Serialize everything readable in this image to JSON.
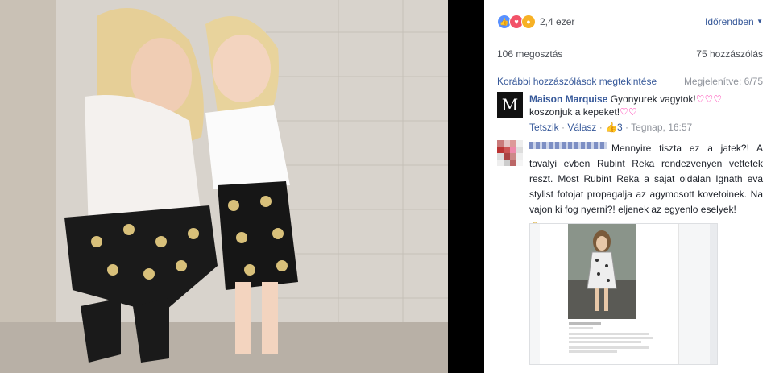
{
  "reactions": {
    "icons": [
      "like-icon",
      "love-icon",
      "wow-icon"
    ],
    "count": "2,4 ezer"
  },
  "sort": {
    "label": "Időrendben"
  },
  "stats": {
    "shares": "106 megosztás",
    "comments": "75 hozzászólás"
  },
  "comments_header": {
    "previous": "Korábbi hozzászólások megtekintése",
    "shown": "Megjelenítve: 6/75"
  },
  "comment1": {
    "author": "Maison Marquise",
    "text_a": "Gyonyurek vagytok!",
    "text_b": "koszonjuk a kepeket!",
    "like_action": "Tetszik",
    "reply_action": "Válasz",
    "like_count": "3",
    "time": "Tegnap, 16:57"
  },
  "comment2": {
    "text": "Mennyire tiszta ez a jatek?! A tavalyi evben Rubint Reka rendezvenyen vettetek reszt. Most Rubint Reka a sajat oldalan Ignath eva stylist fotojat propagalja az agymosott kovetoinek. Na vajon ki fog nyerni?! eljenek az egyenlo eselyek!"
  },
  "colors": {
    "link": "#365899",
    "muted": "#90949c",
    "text": "#1d2129",
    "like": "#5890ff",
    "love": "#f25268",
    "wow": "#f7b125"
  }
}
